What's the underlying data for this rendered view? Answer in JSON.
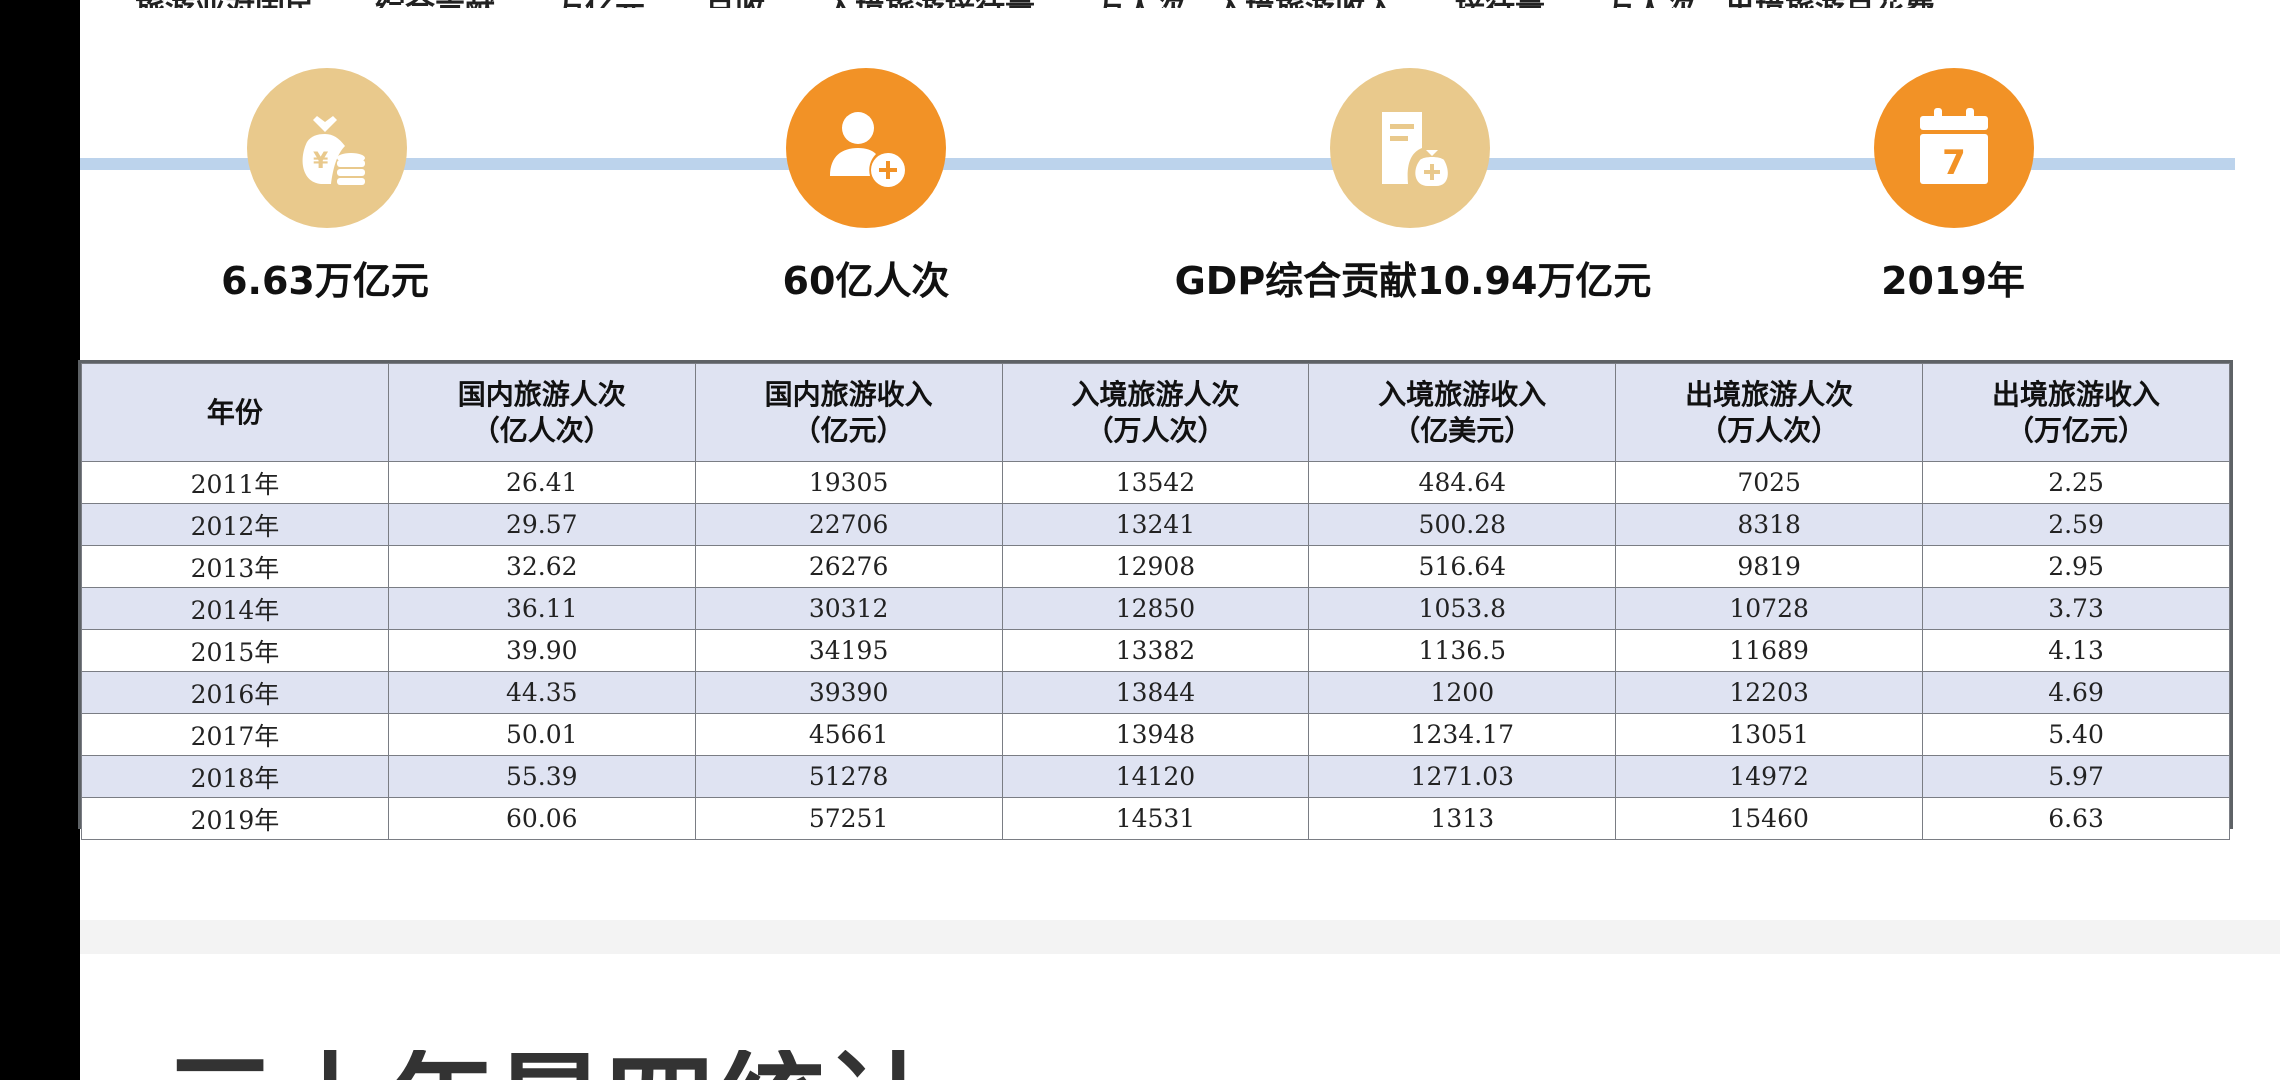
{
  "top_text": "…旅游业对国民……综合贡献……万亿元……总收……入境旅游接待量……万人次，入境旅游收入……接待量……万人次，出境旅游总花费……",
  "stats": [
    {
      "value": "6.63万亿元",
      "icon": "money-bag-icon",
      "color": "#e9c98c"
    },
    {
      "value": "60亿人次",
      "icon": "add-person-icon",
      "color": "#f29226"
    },
    {
      "value": "GDP综合贡献10.94万亿元",
      "icon": "document-money-icon",
      "color": "#e9c98c"
    },
    {
      "value": "2019年",
      "icon": "calendar-icon",
      "color": "#f29226"
    }
  ],
  "table": {
    "headers": [
      {
        "l1": "年份",
        "l2": ""
      },
      {
        "l1": "国内旅游人次",
        "l2": "（亿人次）"
      },
      {
        "l1": "国内旅游收入",
        "l2": "（亿元）"
      },
      {
        "l1": "入境旅游人次",
        "l2": "（万人次）"
      },
      {
        "l1": "入境旅游收入",
        "l2": "（亿美元）"
      },
      {
        "l1": "出境旅游人次",
        "l2": "（万人次）"
      },
      {
        "l1": "出境旅游收入",
        "l2": "（万亿元）"
      }
    ],
    "rows": [
      [
        "2011年",
        "26.41",
        "19305",
        "13542",
        "484.64",
        "7025",
        "2.25"
      ],
      [
        "2012年",
        "29.57",
        "22706",
        "13241",
        "500.28",
        "8318",
        "2.59"
      ],
      [
        "2013年",
        "32.62",
        "26276",
        "12908",
        "516.64",
        "9819",
        "2.95"
      ],
      [
        "2014年",
        "36.11",
        "30312",
        "12850",
        "1053.8",
        "10728",
        "3.73"
      ],
      [
        "2015年",
        "39.90",
        "34195",
        "13382",
        "1136.5",
        "11689",
        "4.13"
      ],
      [
        "2016年",
        "44.35",
        "39390",
        "13844",
        "1200",
        "12203",
        "4.69"
      ],
      [
        "2017年",
        "50.01",
        "45661",
        "13948",
        "1234.17",
        "13051",
        "5.40"
      ],
      [
        "2018年",
        "55.39",
        "51278",
        "14120",
        "1271.03",
        "14972",
        "5.97"
      ],
      [
        "2019年",
        "60.06",
        "57251",
        "14531",
        "1313",
        "15460",
        "6.63"
      ]
    ]
  },
  "bottom_heading": "三十年是四统计"
}
